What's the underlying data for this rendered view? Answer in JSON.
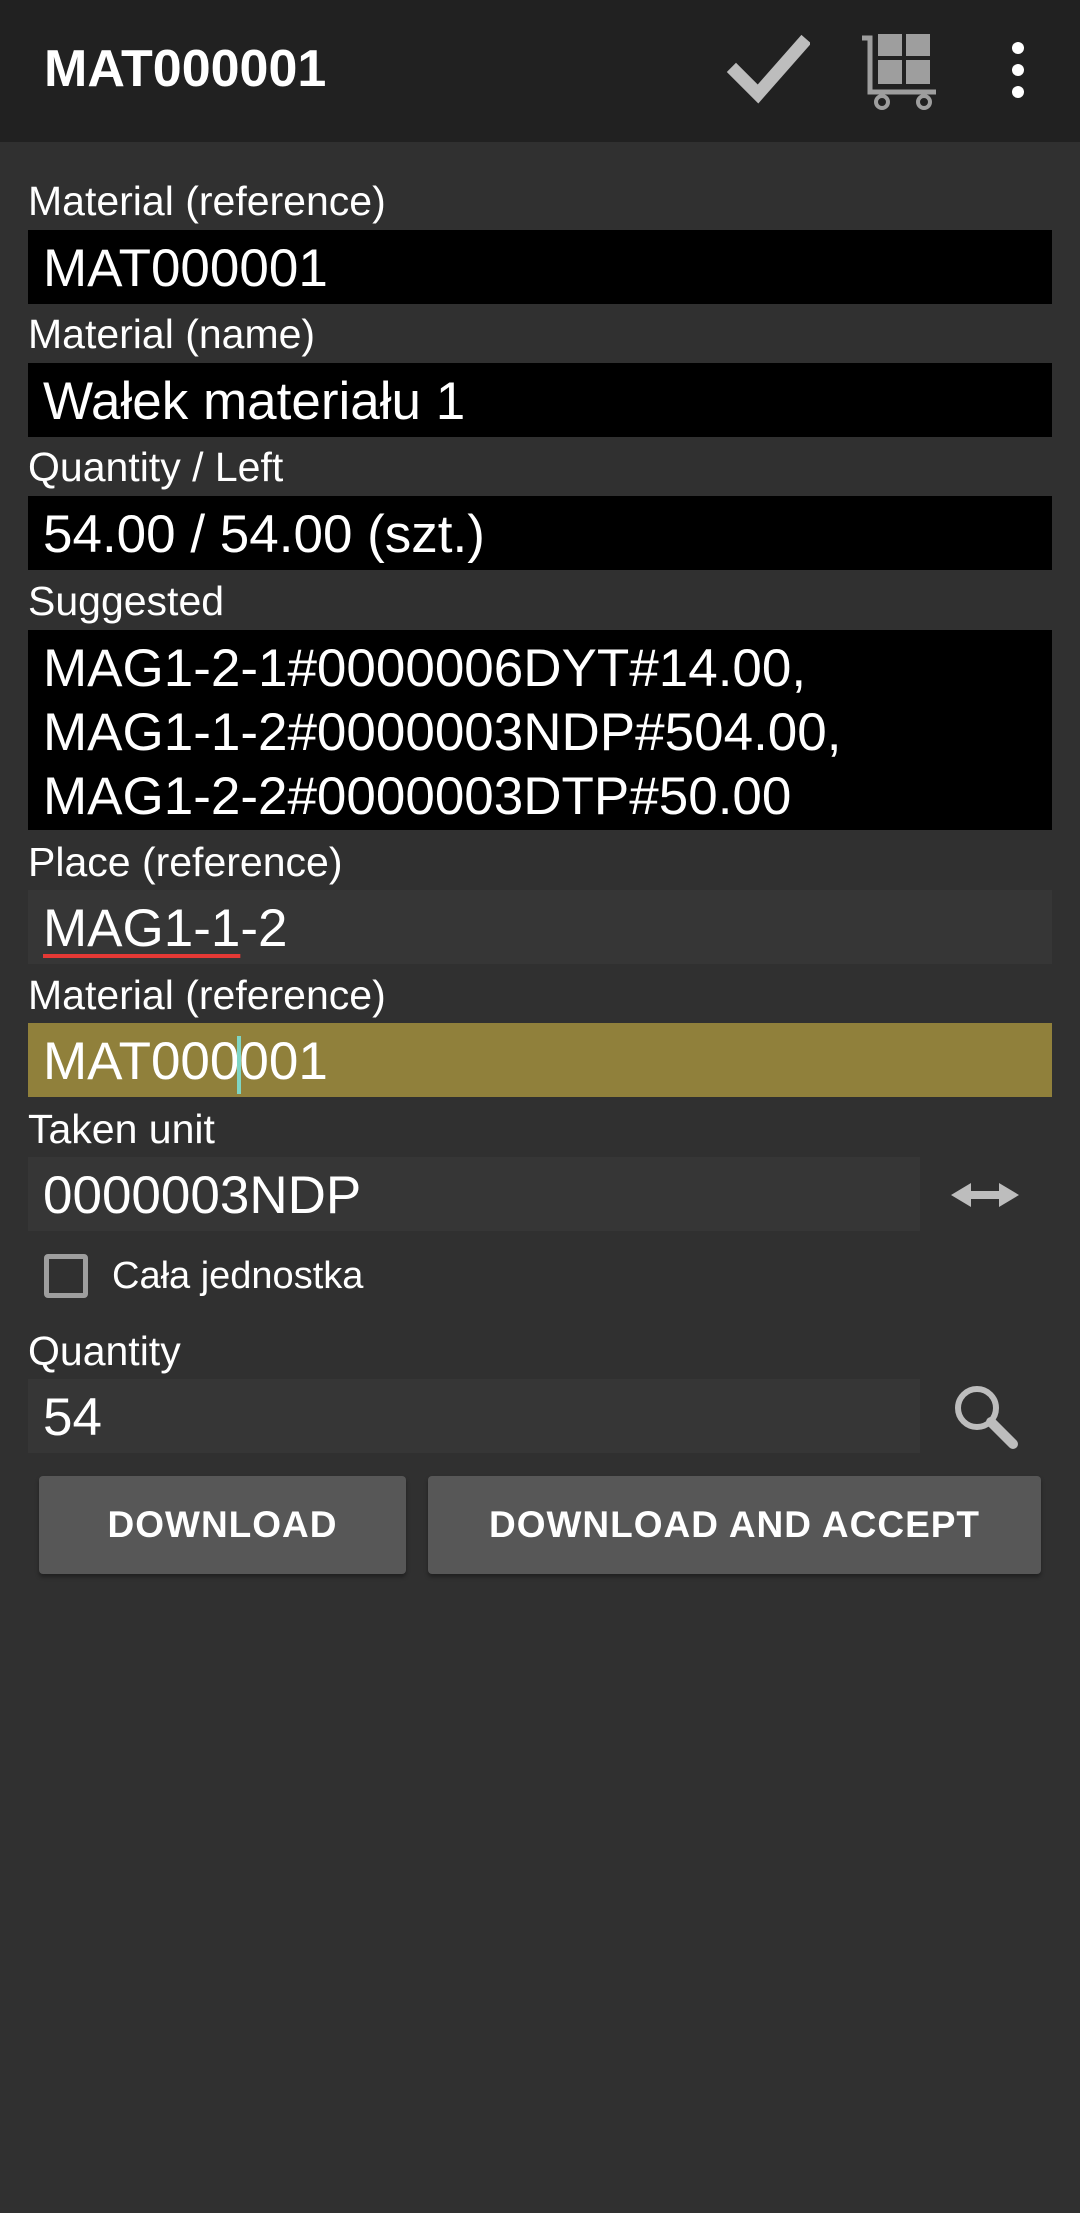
{
  "appbar": {
    "title": "MAT000001",
    "icons": [
      "checkmark-icon",
      "cart-icon",
      "more-vert-icon"
    ]
  },
  "form": {
    "material_ref_label": "Material (reference)",
    "material_ref_value": "MAT000001",
    "material_name_label": "Material (name)",
    "material_name_value": "Wałek materiału 1",
    "quantity_left_label": "Quantity / Left",
    "quantity_left_value": "54.00 / 54.00 (szt.)",
    "suggested_label": "Suggested",
    "suggested_lines": [
      "MAG1-2-1#0000006DYT#14.00,",
      "MAG1-1-2#0000003NDP#504.00,",
      "MAG1-2-2#0000003DTP#50.00"
    ],
    "place_ref_label": "Place (reference)",
    "place_ref_value_underlined": "MAG1-1",
    "place_ref_value_rest": "-2",
    "material_ref2_label": "Material (reference)",
    "material_ref2_before_caret": "MAT000",
    "material_ref2_after_caret": "001",
    "taken_unit_label": "Taken unit",
    "taken_unit_value": "0000003NDP",
    "whole_unit_checkbox_label": "Cała jednostka",
    "whole_unit_checked": false,
    "quantity_label": "Quantity",
    "quantity_value": "54"
  },
  "buttons": {
    "download": "DOWNLOAD",
    "download_accept": "DOWNLOAD AND ACCEPT"
  },
  "colors": {
    "background": "#303030",
    "appbar": "#212121",
    "readonly_field": "#000000",
    "input_field": "#363636",
    "focused_field": "#90803b",
    "button": "#575757",
    "caret": "#7fd6c4",
    "spellcheck_underline": "#e53935"
  }
}
